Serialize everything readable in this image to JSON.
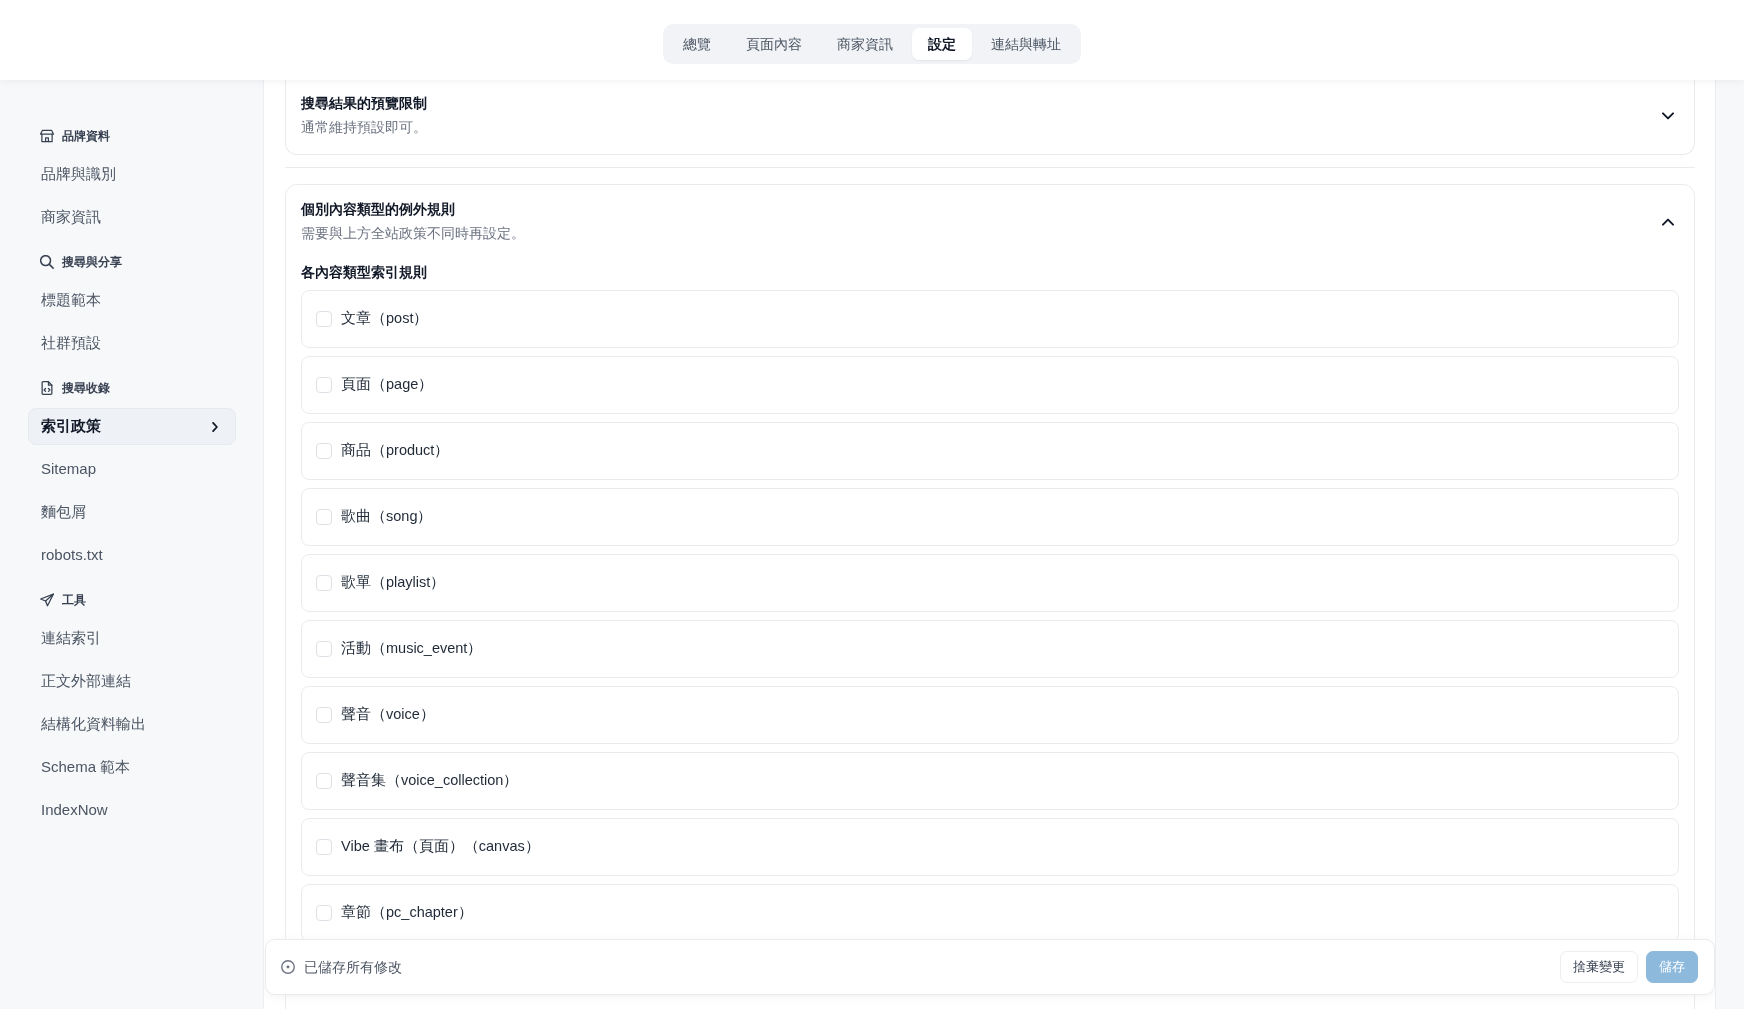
{
  "tabs": [
    {
      "label": "總覽",
      "selected": false
    },
    {
      "label": "頁面內容",
      "selected": false
    },
    {
      "label": "商家資訊",
      "selected": false
    },
    {
      "label": "設定",
      "selected": true
    },
    {
      "label": "連結與轉址",
      "selected": false
    }
  ],
  "sidebar": {
    "sections": [
      {
        "title": "品牌資料",
        "items": [
          {
            "label": "品牌與識別",
            "selected": false
          },
          {
            "label": "商家資訊",
            "selected": false
          }
        ]
      },
      {
        "title": "搜尋與分享",
        "items": [
          {
            "label": "標題範本",
            "selected": false
          },
          {
            "label": "社群預設",
            "selected": false
          }
        ]
      },
      {
        "title": "搜尋收錄",
        "items": [
          {
            "label": "索引政策",
            "selected": true
          },
          {
            "label": "Sitemap",
            "selected": false
          },
          {
            "label": "麵包屑",
            "selected": false
          },
          {
            "label": "robots.txt",
            "selected": false
          }
        ]
      },
      {
        "title": "工具",
        "items": [
          {
            "label": "連結索引",
            "selected": false
          },
          {
            "label": "正文外部連結",
            "selected": false
          },
          {
            "label": "結構化資料輸出",
            "selected": false
          },
          {
            "label": "Schema 範本",
            "selected": false
          },
          {
            "label": "IndexNow",
            "selected": false
          }
        ]
      }
    ]
  },
  "panels": [
    {
      "title": "搜尋結果的預覽限制",
      "description": "通常維持預設即可。",
      "expanded": false
    },
    {
      "title": "個別內容類型的例外規則",
      "description": "需要與上方全站政策不同時再設定。",
      "expanded": true,
      "group_label": "各內容類型索引規則",
      "options": [
        {
          "label": "文章（post）",
          "checked": false
        },
        {
          "label": "頁面（page）",
          "checked": false
        },
        {
          "label": "商品（product）",
          "checked": false
        },
        {
          "label": "歌曲（song）",
          "checked": false
        },
        {
          "label": "歌單（playlist）",
          "checked": false
        },
        {
          "label": "活動（music_event）",
          "checked": false
        },
        {
          "label": "聲音（voice）",
          "checked": false
        },
        {
          "label": "聲音集（voice_collection）",
          "checked": false
        },
        {
          "label": "Vibe 畫布（頁面）（canvas）",
          "checked": false
        },
        {
          "label": "章節（pc_chapter）",
          "checked": false
        }
      ]
    }
  ],
  "save_bar": {
    "status": "已儲存所有修改",
    "buttons": [
      {
        "label": "捨棄變更",
        "kind": "secondary",
        "disabled": false
      },
      {
        "label": "儲存",
        "kind": "primary",
        "disabled": true
      }
    ]
  }
}
